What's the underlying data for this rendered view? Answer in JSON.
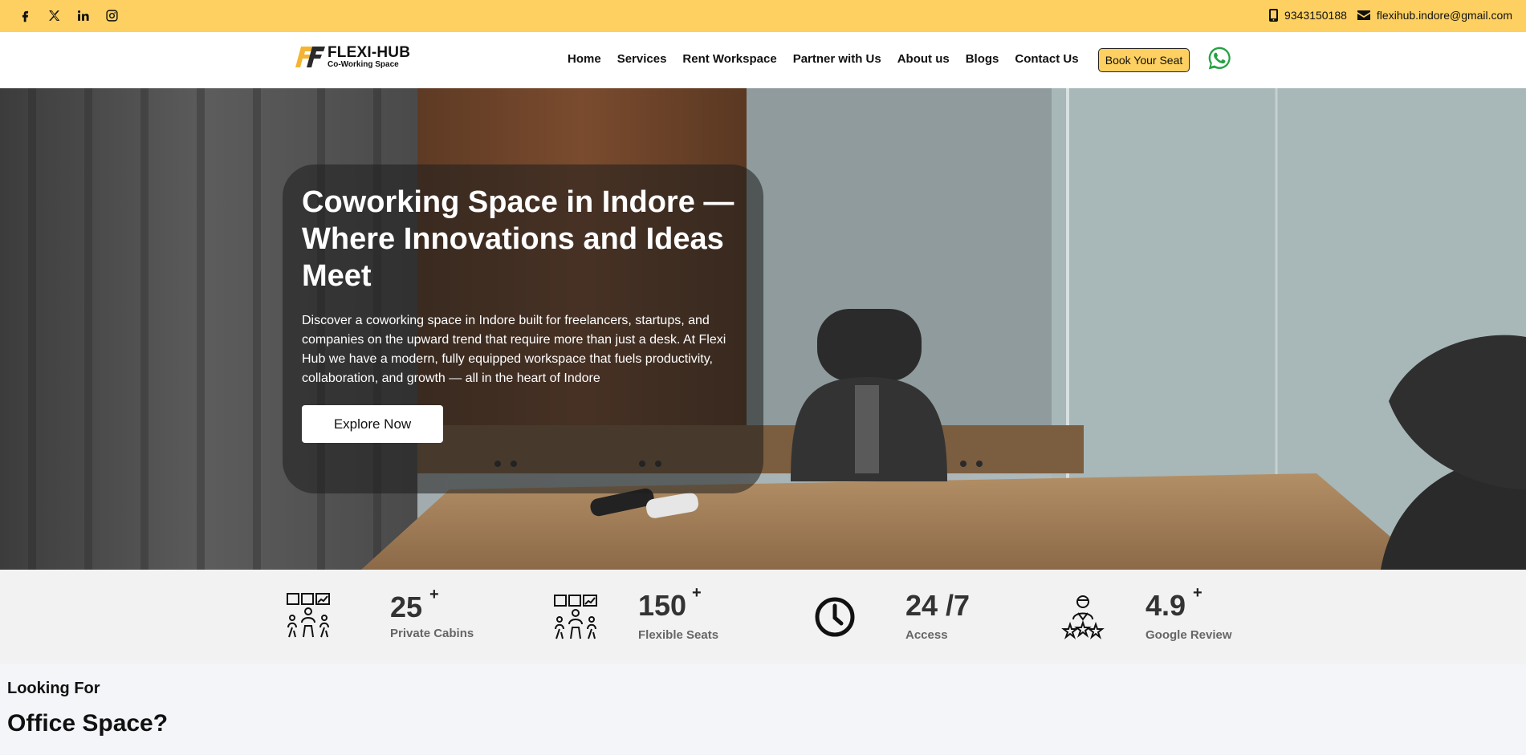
{
  "topbar": {
    "social_icons": [
      "facebook-icon",
      "x-icon",
      "linkedin-icon",
      "instagram-icon"
    ],
    "phone": "9343150188",
    "email": "flexihub.indore@gmail.com",
    "bg_color": "#fdd061"
  },
  "header": {
    "logo_title": "FLEXI-HUB",
    "logo_sub": "Co-Working Space",
    "nav": [
      "Home",
      "Services",
      "Rent Workspace",
      "Partner with Us",
      "About us",
      "Blogs",
      "Contact Us"
    ],
    "book_label": "Book Your Seat",
    "whatsapp_icon": "whatsapp-icon",
    "accent_color": "#fdd061"
  },
  "hero": {
    "title": "Coworking Space in Indore — Where Innovations and Ideas Meet",
    "description": "Discover a coworking space in Indore built for freelancers, startups, and companies on the upward trend that require more than just a desk. At Flexi Hub we have a modern, fully equipped workspace that fuels productivity, collaboration, and growth — all in the heart of Indore",
    "cta": "Explore Now"
  },
  "stats": [
    {
      "value": "25",
      "plus": "+",
      "label": "Private Cabins",
      "icon": "meeting-icon"
    },
    {
      "value": "150",
      "plus": "+",
      "label": "Flexible Seats",
      "icon": "meeting-icon"
    },
    {
      "value": "24 /7",
      "plus": "",
      "label": "Access",
      "icon": "clock-icon"
    },
    {
      "value": "4.9",
      "plus": "+",
      "label": "Google Review",
      "icon": "review-icon"
    }
  ],
  "section": {
    "eyebrow": "Looking For",
    "heading": "Office Space?"
  }
}
